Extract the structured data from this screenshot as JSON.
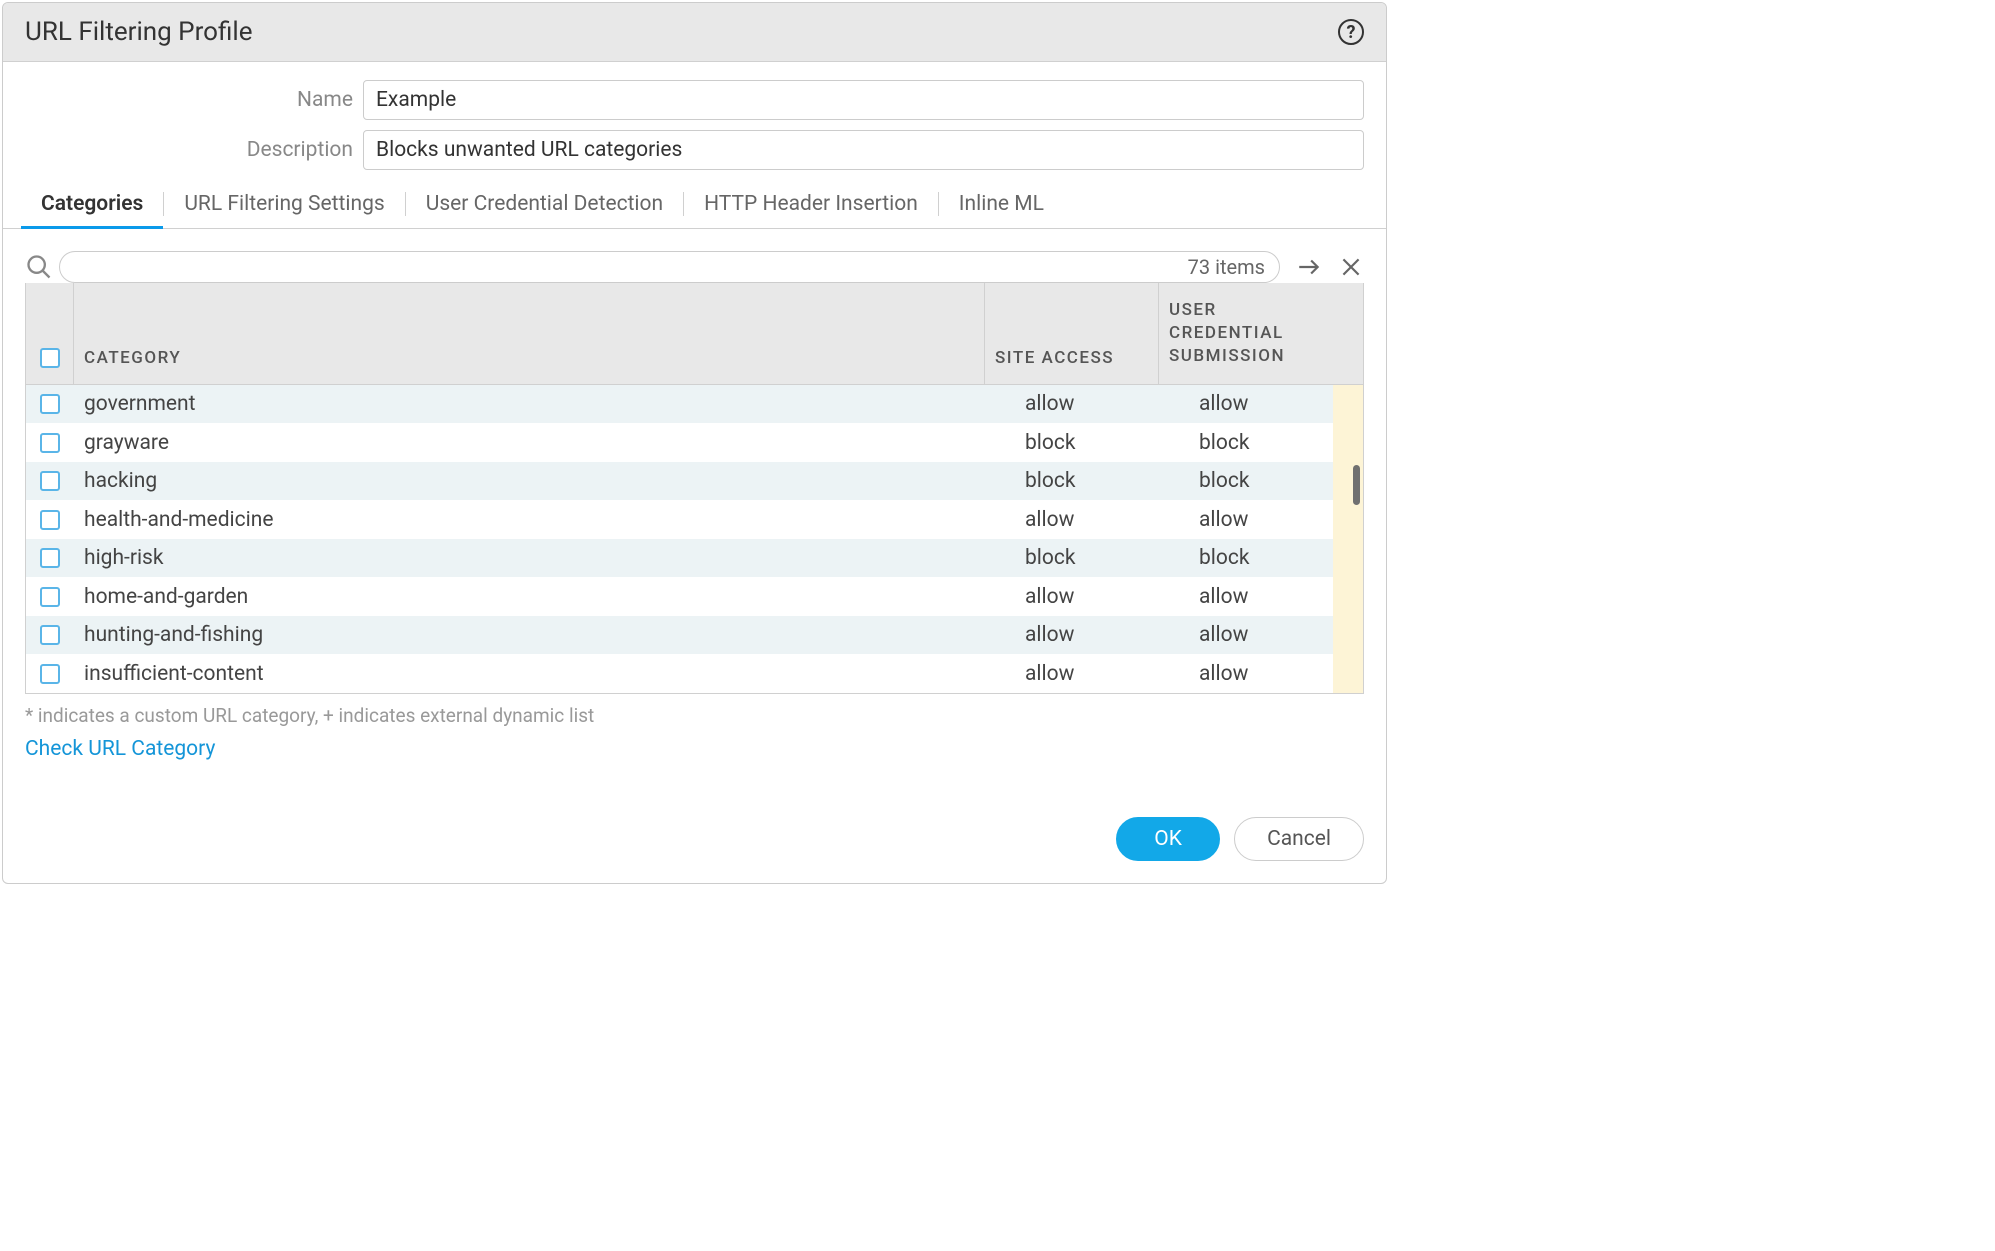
{
  "dialog": {
    "title": "URL Filtering Profile"
  },
  "form": {
    "name_label": "Name",
    "name_value": "Example",
    "desc_label": "Description",
    "desc_value": "Blocks unwanted URL categories"
  },
  "tabs": [
    {
      "label": "Categories",
      "active": true
    },
    {
      "label": "URL Filtering Settings",
      "active": false
    },
    {
      "label": "User Credential Detection",
      "active": false
    },
    {
      "label": "HTTP Header Insertion",
      "active": false
    },
    {
      "label": "Inline ML",
      "active": false
    }
  ],
  "grid": {
    "item_count_text": "73 items",
    "columns": {
      "category": "CATEGORY",
      "site_access": "SITE ACCESS",
      "user_cred": "USER CREDENTIAL SUBMISSION"
    },
    "rows": [
      {
        "category": "government",
        "site": "allow",
        "user": "allow"
      },
      {
        "category": "grayware",
        "site": "block",
        "user": "block"
      },
      {
        "category": "hacking",
        "site": "block",
        "user": "block"
      },
      {
        "category": "health-and-medicine",
        "site": "allow",
        "user": "allow"
      },
      {
        "category": "high-risk",
        "site": "block",
        "user": "block"
      },
      {
        "category": "home-and-garden",
        "site": "allow",
        "user": "allow"
      },
      {
        "category": "hunting-and-fishing",
        "site": "allow",
        "user": "allow"
      },
      {
        "category": "insufficient-content",
        "site": "allow",
        "user": "allow"
      }
    ]
  },
  "footnote": "* indicates a custom URL category, + indicates external dynamic list",
  "link_text": "Check URL Category",
  "buttons": {
    "ok": "OK",
    "cancel": "Cancel"
  }
}
